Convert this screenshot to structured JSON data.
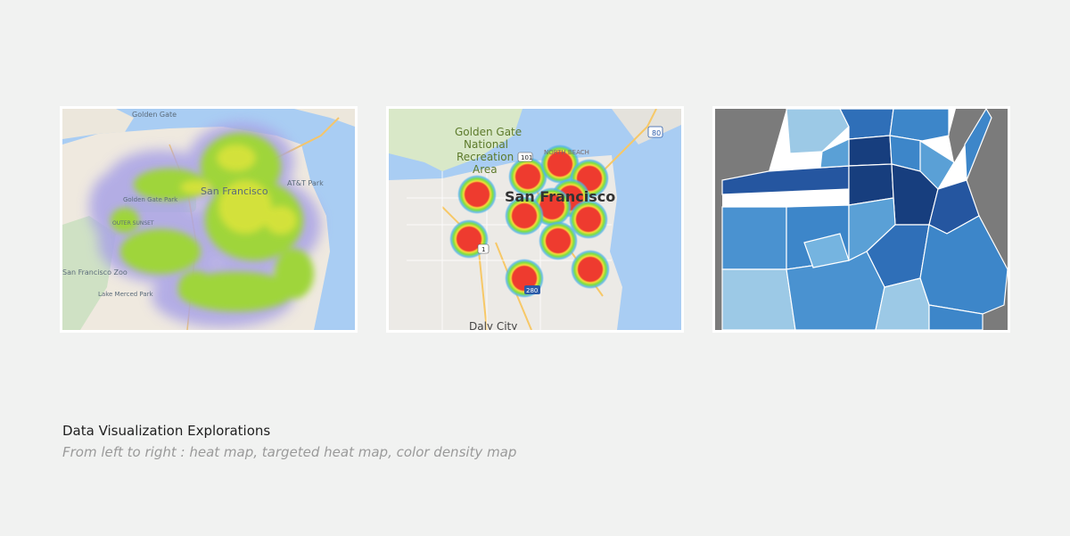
{
  "caption": {
    "title": "Data Visualization Explorations",
    "subtitle": "From left to right : heat map, targeted heat map, color density map"
  },
  "maps": [
    {
      "kind": "heat map",
      "labels": {
        "golden_gate": "Golden Gate",
        "sf": "San Francisco",
        "park": "AT&T Park",
        "gg_park": "Golden Gate Park",
        "zoo": "San Francisco Zoo",
        "lake": "Lake Merced Park",
        "sunset": "OUTER SUNSET"
      }
    },
    {
      "kind": "targeted heat map",
      "labels": {
        "gg_line1": "Golden Gate",
        "gg_line2": "National",
        "gg_line3": "Recreation",
        "gg_line4": "Area",
        "sf": "San Francisco",
        "daly": "Daly City",
        "north_beach": "NORTH BEACH",
        "hwy101": "101",
        "hwy80": "80",
        "hwy1": "1",
        "hwy280": "280"
      }
    },
    {
      "kind": "color density map"
    }
  ],
  "colors": {
    "page_bg": "#f1f2f1",
    "water": "#a9cdf3",
    "land": "#eae6df",
    "heat_low": "#a9a3e6",
    "heat_mid": "#9fd53a",
    "heat_high": "#d9e33a",
    "target_core": "#ee3b2f",
    "density_dark": "#173e7e",
    "density_mid": "#3d86c9",
    "density_light": "#9cc9e6",
    "density_bg": "#7b7b7b"
  }
}
